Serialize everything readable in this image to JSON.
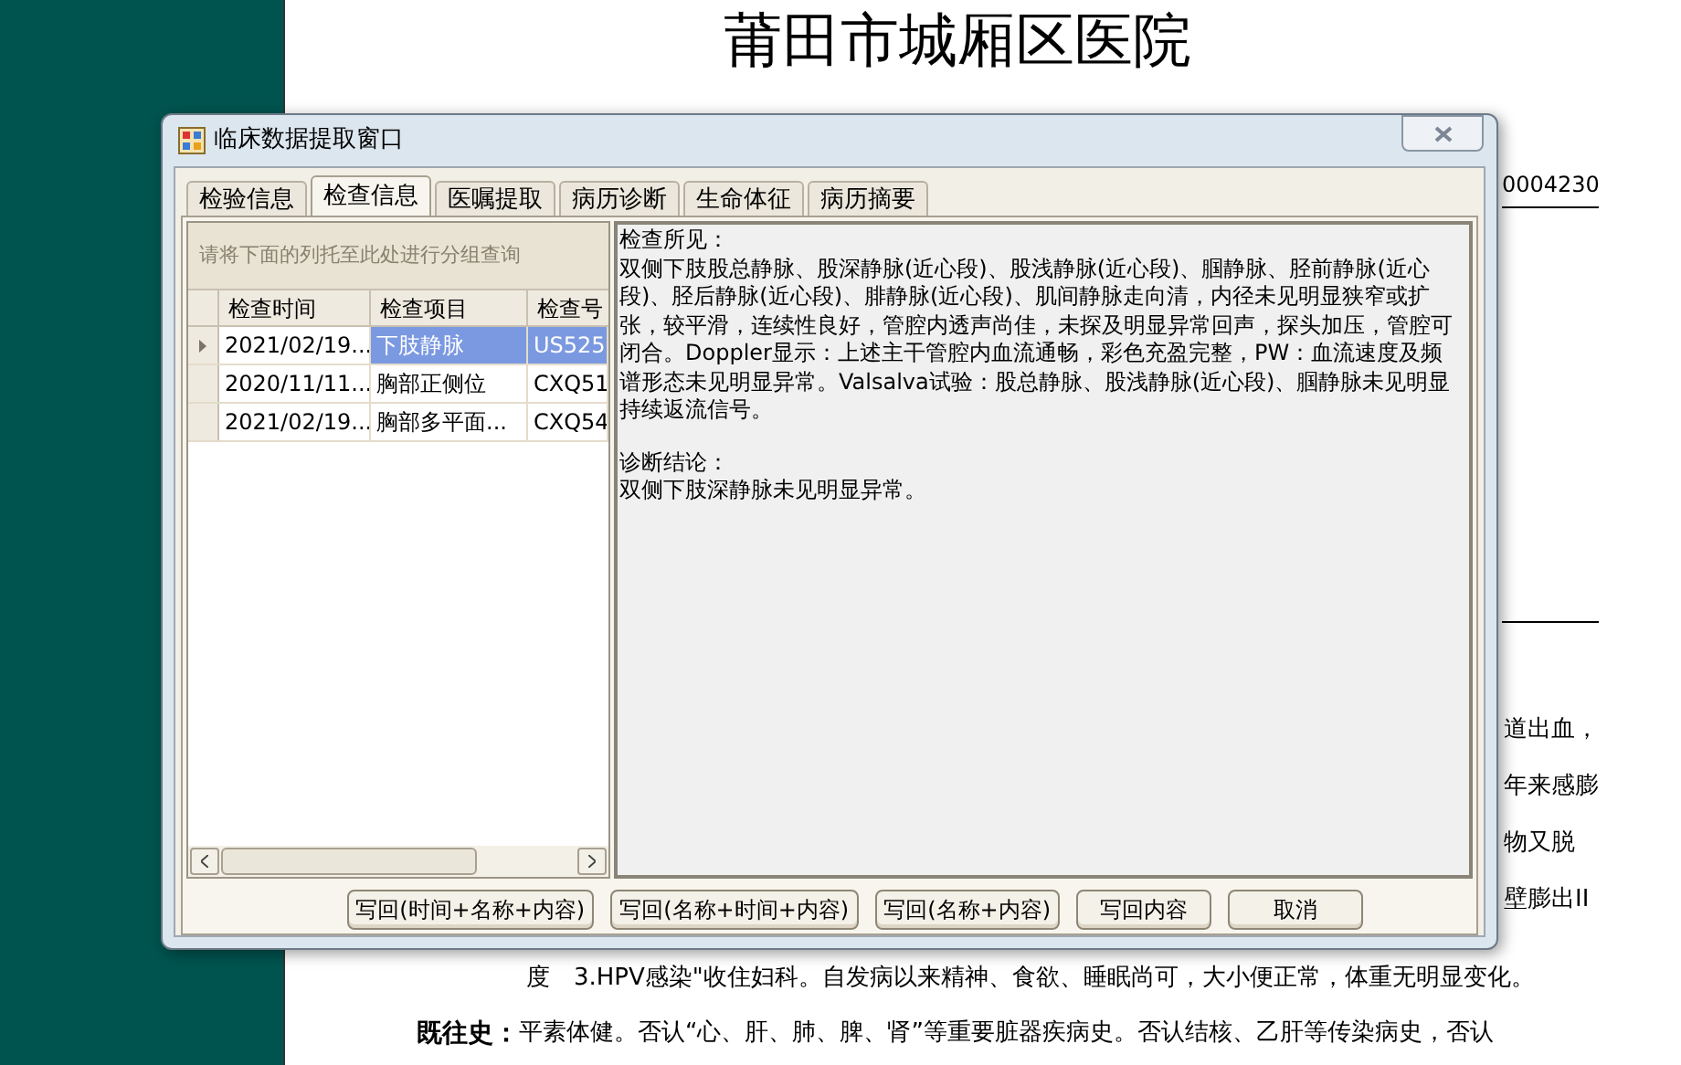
{
  "document": {
    "title": "莆田市城厢区医院",
    "record_number": "0004230",
    "edge_fragments": [
      "道出血，",
      "年来感膨",
      "物又脱",
      "壁膨出II"
    ],
    "lines": [
      {
        "text": "度　3.HPV感染\"收住妇科。自发病以来精神、食欲、睡眠尚可，大小便正常，体重无明显变化。"
      },
      {
        "label": "既往史：",
        "text": "平素体健。否认“心、肝、肺、脾、肾”等重要脏器疾病史。否认结核、乙肝等传染病史，否认"
      }
    ]
  },
  "window": {
    "title": "临床数据提取窗口"
  },
  "tabs": [
    {
      "label": "检验信息",
      "selected": false
    },
    {
      "label": "检查信息",
      "selected": true
    },
    {
      "label": "医嘱提取",
      "selected": false
    },
    {
      "label": "病历诊断",
      "selected": false
    },
    {
      "label": "生命体征",
      "selected": false
    },
    {
      "label": "病历摘要",
      "selected": false
    }
  ],
  "group_hint": "请将下面的列托至此处进行分组查询",
  "table": {
    "columns": [
      "检查时间",
      "检查项目",
      "检查号"
    ],
    "rows": [
      {
        "cells": [
          "2021/02/19...",
          "下肢静脉",
          "US525"
        ],
        "selected": true
      },
      {
        "cells": [
          "2020/11/11...",
          "胸部正侧位",
          "CXQ51"
        ],
        "selected": false
      },
      {
        "cells": [
          "2021/02/19...",
          "胸部多平面...",
          "CXQ54"
        ],
        "selected": false
      }
    ]
  },
  "report": [
    {
      "heading": "检查所见：",
      "body": "双侧下肢股总静脉、股深静脉(近心段)、股浅静脉(近心段)、腘静脉、胫前静脉(近心段)、胫后静脉(近心段)、腓静脉(近心段)、肌间静脉走向清，内径未见明显狭窄或扩张，较平滑，连续性良好，管腔内透声尚佳，未探及明显异常回声，探头加压，管腔可闭合。Doppler显示：上述主干管腔内血流通畅，彩色充盈完整，PW：血流速度及频谱形态未见明显异常。Valsalva试验：股总静脉、股浅静脉(近心段)、腘静脉未见明显持续返流信号。"
    },
    {
      "heading": "诊断结论：",
      "body": "双侧下肢深静脉未见明显异常。"
    }
  ],
  "buttons": [
    "写回(时间+名称+内容)",
    "写回(名称+时间+内容)",
    "写回(名称+内容)",
    "写回内容",
    "取消"
  ]
}
